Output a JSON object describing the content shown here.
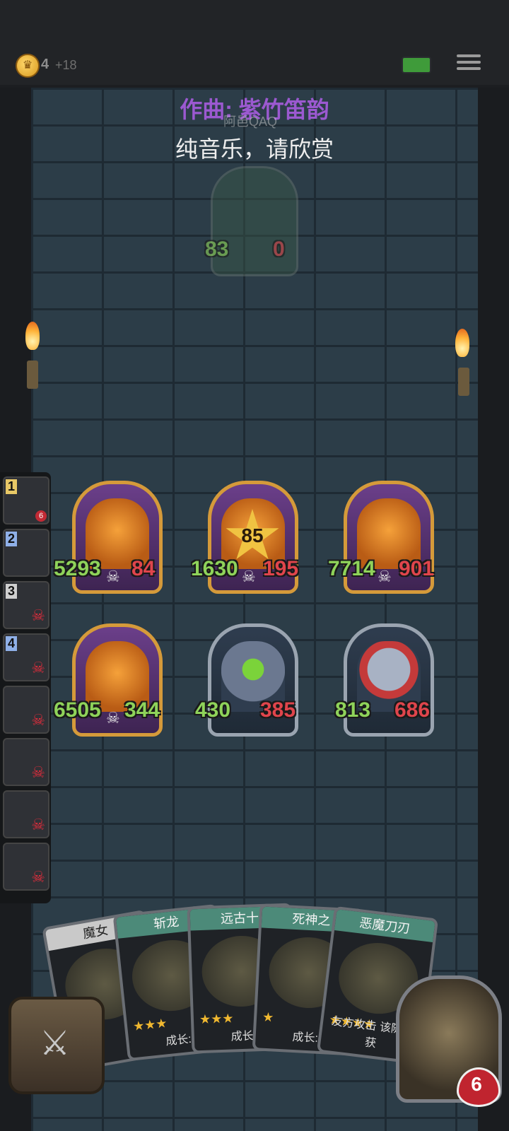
{
  "topbar": {
    "gold_icon": "crown-coin-icon",
    "gold": "4",
    "gold_bonus": "+18",
    "menu_icon": "hamburger-icon"
  },
  "music": {
    "title": "作曲: 紫竹笛韵",
    "subtitle": "纯音乐，请欣赏"
  },
  "enemy": {
    "name": "阿邑QAQ",
    "atk": "83",
    "hp": "0"
  },
  "board": {
    "minions": [
      {
        "atk": "5293",
        "hp": "84"
      },
      {
        "atk": "1630",
        "hp": "195",
        "star": "85"
      },
      {
        "atk": "7714",
        "hp": "901"
      },
      {
        "atk": "6505",
        "hp": "344"
      },
      {
        "atk": "430",
        "hp": "385"
      },
      {
        "atk": "813",
        "hp": "686"
      }
    ]
  },
  "rail": [
    {
      "num": "1",
      "hp": "6"
    },
    {
      "num": "2"
    },
    {
      "num": "3"
    },
    {
      "num": "4"
    },
    {
      "num": ""
    },
    {
      "num": ""
    },
    {
      "num": ""
    },
    {
      "num": ""
    }
  ],
  "hand": [
    {
      "title": "魔女",
      "desc": ""
    },
    {
      "title": "斩龙",
      "desc": "成长:"
    },
    {
      "title": "远古十",
      "desc": "成长:"
    },
    {
      "title": "死神之",
      "desc": "成长:"
    },
    {
      "title": "恶魔刀刃",
      "desc": "友方攻击 该随从获"
    }
  ],
  "hero": {
    "hp": "6"
  }
}
